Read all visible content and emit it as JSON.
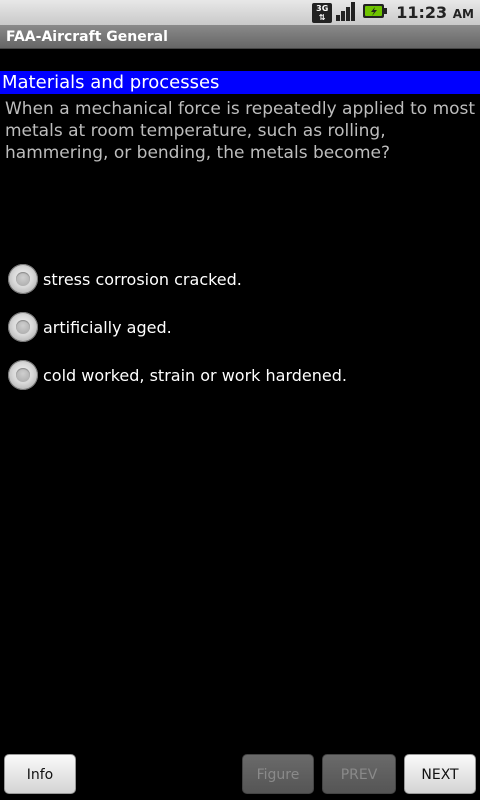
{
  "status_bar": {
    "network_label": "3G",
    "time": "11:23",
    "ampm": "AM"
  },
  "app": {
    "title": "FAA-Aircraft General"
  },
  "quiz": {
    "category": "Materials and processes",
    "question": "When a mechanical force is repeatedly applied to most metals at room temperature, such as rolling, hammering, or bending, the metals become?",
    "options": [
      {
        "label": "stress corrosion cracked."
      },
      {
        "label": "artificially aged."
      },
      {
        "label": "cold worked, strain or work hardened."
      }
    ]
  },
  "buttons": {
    "info": "Info",
    "figure": "Figure",
    "prev": "PREV",
    "next": "NEXT"
  },
  "colors": {
    "category_bg": "#0000ff",
    "question_text": "#bdbdbd",
    "battery_green": "#6fc400"
  }
}
